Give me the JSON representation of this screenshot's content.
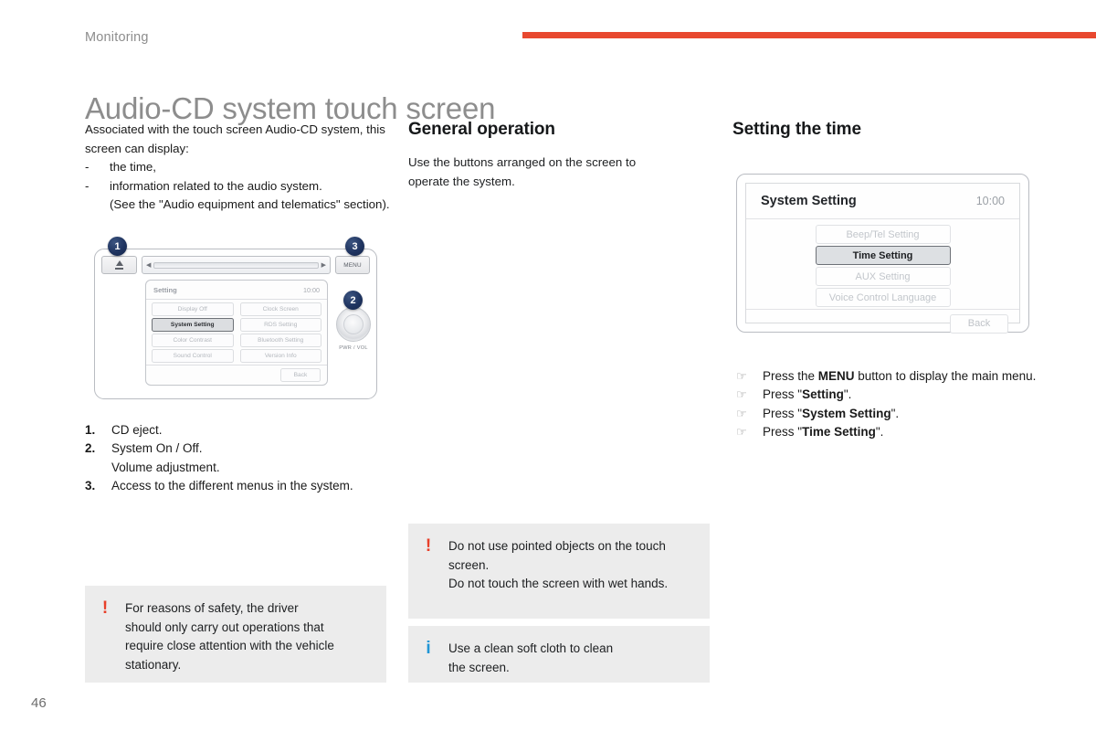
{
  "header": {
    "running_head": "Monitoring",
    "title": "Audio-CD system touch screen",
    "rule_color": "#e8482f"
  },
  "folio": "46",
  "left_column": {
    "intro_line1": "Associated with the touch screen Audio-CD system, this",
    "intro_line2": "screen can display:",
    "bullets": [
      {
        "marker": "-",
        "text": "the time,"
      },
      {
        "marker": "-",
        "text": "information related to the audio system."
      }
    ],
    "bullet_continuation": "(See the \"Audio equipment and telematics\" section).",
    "legend": [
      {
        "num": "1.",
        "label": "CD eject."
      },
      {
        "num": "2.",
        "label": "System On / Off."
      },
      {
        "num": "",
        "label": "Volume adjustment."
      },
      {
        "num": "3.",
        "label": "Access to the different menus in the system."
      }
    ]
  },
  "head_unit": {
    "eject_icon": "eject-icon",
    "menu_button": "MENU",
    "knob_label": "PWR / VOL",
    "callouts": [
      "1",
      "2",
      "3"
    ],
    "screen": {
      "title": "Setting",
      "clock": "10:00",
      "buttons": [
        {
          "label": "Display Off",
          "selected": false
        },
        {
          "label": "Clock Screen",
          "selected": false
        },
        {
          "label": "System Setting",
          "selected": true
        },
        {
          "label": "RDS Setting",
          "selected": false
        },
        {
          "label": "Color Contrast",
          "selected": false
        },
        {
          "label": "Bluetooth Setting",
          "selected": false
        },
        {
          "label": "Sound Control",
          "selected": false
        },
        {
          "label": "Version Info",
          "selected": false
        }
      ],
      "back_label": "Back"
    }
  },
  "middle_column": {
    "heading": "General operation",
    "body_line1": "Use the buttons arranged on the screen to",
    "body_line2": "operate the system."
  },
  "right_column": {
    "heading": "Setting the time",
    "system_screen": {
      "title": "System Setting",
      "clock": "10:00",
      "buttons": [
        {
          "label": "Beep/Tel Setting",
          "selected": false
        },
        {
          "label": "Time Setting",
          "selected": true
        },
        {
          "label": "AUX Setting",
          "selected": false
        },
        {
          "label": "Voice Control Language",
          "selected": false
        }
      ],
      "back_label": "Back"
    },
    "steps": [
      {
        "marker": "☞",
        "pre": "Press the ",
        "bold": "MENU",
        "post": " button to display the main menu."
      },
      {
        "marker": "☞",
        "pre": "Press \"",
        "bold": "Setting",
        "post": "\"."
      },
      {
        "marker": "☞",
        "pre": "Press \"",
        "bold": "System Setting",
        "post": "\"."
      },
      {
        "marker": "☞",
        "pre": "Press \"",
        "bold": "Time Setting",
        "post": "\"."
      }
    ]
  },
  "notices": {
    "warning_right": {
      "icon": "warning-exclamation-icon",
      "icon_color": "#e8402a",
      "line1": "Do not use pointed objects on the touch",
      "line2": "screen.",
      "line3": "Do not touch the screen with wet hands."
    },
    "info_right": {
      "icon": "information-icon",
      "icon_color": "#2196d6",
      "line1": "Use a clean soft cloth to clean",
      "line2": "the screen."
    },
    "warning_left": {
      "icon": "warning-exclamation-icon",
      "icon_color": "#e8402a",
      "line1": "For reasons of safety, the driver",
      "line2": "should only carry out operations that",
      "line3": "require close attention with the vehicle",
      "line4": "stationary."
    }
  }
}
